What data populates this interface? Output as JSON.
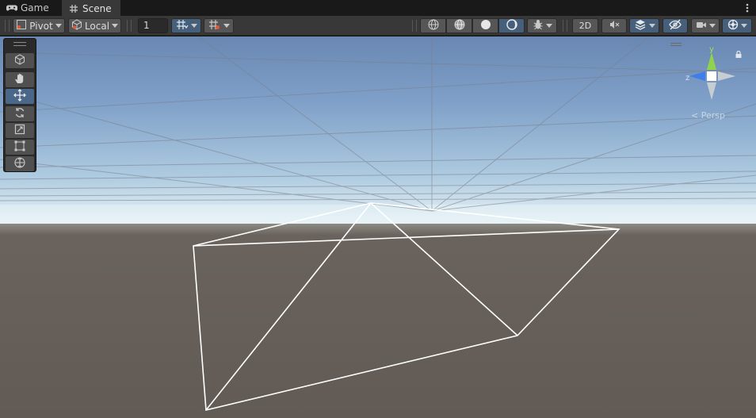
{
  "tabs": [
    {
      "label": "Game",
      "icon": "gamepad-icon",
      "active": false
    },
    {
      "label": "Scene",
      "icon": "grid-hash-icon",
      "active": true
    }
  ],
  "toolbar": {
    "pivot_label": "Pivot",
    "space_label": "Local",
    "snap_increment_value": "1",
    "mode_2d_label": "2D"
  },
  "palette": {
    "tools": [
      "view-tool",
      "hand-tool",
      "move-tool",
      "rotate-tool",
      "scale-tool",
      "rect-tool",
      "transform-tool"
    ],
    "selected_tool": "move-tool"
  },
  "gizmo": {
    "y_label": "y",
    "z_label": "z",
    "projection_label": "< Persp"
  },
  "colors": {
    "panel": "#383838",
    "button": "#565656",
    "active_button": "#46607c",
    "sky_top": "#6b8db6",
    "horizon": "#e9f4f7",
    "ground": "#625b55",
    "wireframe": "#ffffff",
    "gizmo_y": "#8fd24c",
    "gizmo_z": "#3e7ee8"
  }
}
